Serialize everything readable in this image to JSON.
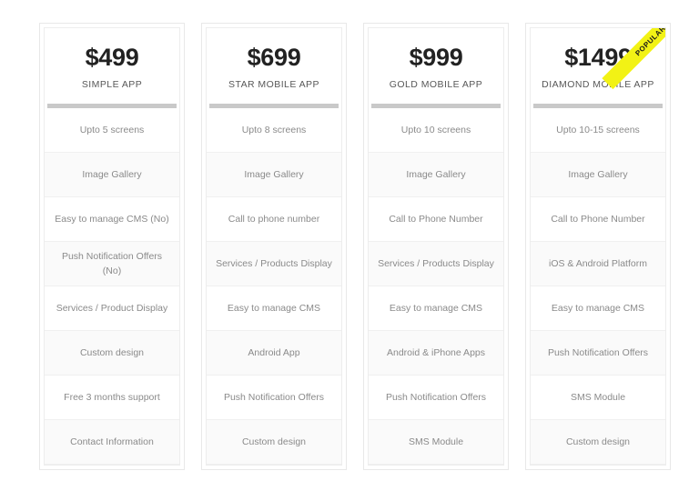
{
  "theme": {
    "page_background": "#ffffff",
    "card_background": "#ffffff",
    "card_border": "#e8e8e8",
    "divider_color": "#c9c9c9",
    "row_alt_background": "#fafafa",
    "price_color": "#222222",
    "plan_name_color": "#585858",
    "feature_text_color": "#8a8a8a",
    "ribbon_background": "#f2f215",
    "ribbon_text_color": "#1a1a1a"
  },
  "ribbon": {
    "label": "POPULAR"
  },
  "plans": [
    {
      "price": "$499",
      "name": "SIMPLE APP",
      "featured": false,
      "features": [
        "Upto 5 screens",
        "Image Gallery",
        "Easy to manage CMS (No)",
        "Push Notification Offers (No)",
        "Services / Product Display",
        "Custom design",
        "Free 3 months support",
        "Contact Information"
      ]
    },
    {
      "price": "$699",
      "name": "STAR MOBILE APP",
      "featured": false,
      "features": [
        "Upto 8 screens",
        "Image Gallery",
        "Call to phone number",
        "Services / Products Display",
        "Easy to manage CMS",
        "Android App",
        "Push Notification Offers",
        "Custom design"
      ]
    },
    {
      "price": "$999",
      "name": "GOLD MOBILE APP",
      "featured": false,
      "features": [
        "Upto 10 screens",
        "Image Gallery",
        "Call to Phone Number",
        "Services / Products Display",
        "Easy to manage CMS",
        "Android & iPhone Apps",
        "Push Notification Offers",
        "SMS Module"
      ]
    },
    {
      "price": "$1499",
      "name": "DIAMOND MOBILE APP",
      "featured": true,
      "features": [
        "Upto 10-15 screens",
        "Image Gallery",
        "Call to Phone Number",
        "iOS & Android Platform",
        "Easy to manage CMS",
        "Push Notification Offers",
        "SMS Module",
        "Custom design"
      ]
    }
  ]
}
